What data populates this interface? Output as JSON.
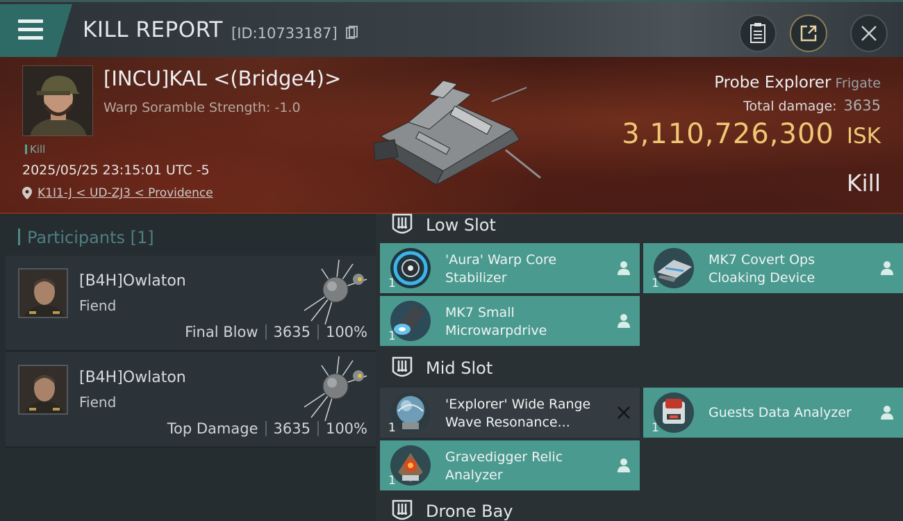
{
  "header": {
    "title": "KILL REPORT",
    "report_id": "[ID:10733187]"
  },
  "victim": {
    "name": "[INCU]KAL <(Bridge4)>",
    "scramble": "Warp Soramble Strength: -1.0",
    "tag": "Kill",
    "datetime": "2025/05/25 23:15:01 UTC -5",
    "location": "K1I1-J < UD-ZJ3 < Providence",
    "ship": "Probe Explorer",
    "ship_class": "Frigate",
    "total_damage_label": "Total damage:",
    "total_damage": "3635",
    "isk_value": "3,110,726,300",
    "isk_unit": "ISK",
    "result": "Kill"
  },
  "participants": {
    "title": "Participants [1]",
    "rows": [
      {
        "name": "[B4H]Owlaton",
        "ship": "Fiend",
        "role": "Final Blow",
        "damage": "3635",
        "percent": "100%"
      },
      {
        "name": "[B4H]Owlaton",
        "ship": "Fiend",
        "role": "Top Damage",
        "damage": "3635",
        "percent": "100%"
      }
    ]
  },
  "fitting": {
    "low_slot": {
      "label": "Low Slot",
      "modules": [
        {
          "name": "'Aura' Warp Core Stabilizer",
          "qty": "1"
        },
        {
          "name": "MK7 Covert Ops Cloaking Device",
          "qty": "1"
        },
        {
          "name": "MK7 Small Microwarpdrive",
          "qty": "1"
        }
      ]
    },
    "mid_slot": {
      "label": "Mid Slot",
      "modules": [
        {
          "name": "'Explorer' Wide Range Wave Resonance...",
          "qty": "1"
        },
        {
          "name": "Guests Data Analyzer",
          "qty": "1"
        },
        {
          "name": "Gravedigger Relic Analyzer",
          "qty": "1"
        }
      ]
    },
    "drone_bay": {
      "label": "Drone Bay"
    }
  },
  "colors": {
    "accent": "#4b9a8f",
    "isk_gold": "#f0c774",
    "banner_red": "#5e2a1c"
  }
}
